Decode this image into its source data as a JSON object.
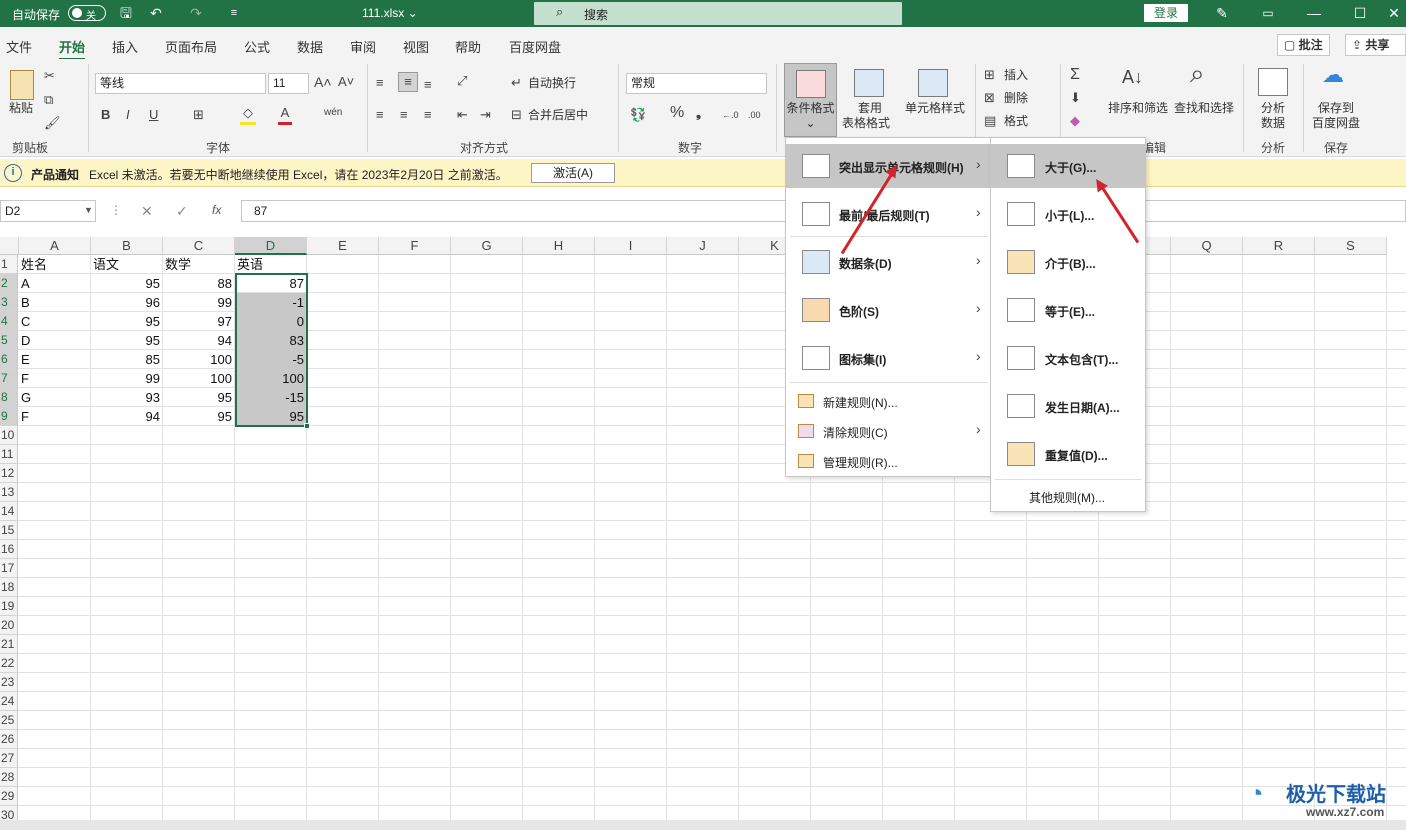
{
  "titlebar": {
    "autosave": "自动保存",
    "autosave_state": "关",
    "filename": "111.xlsx ⌄",
    "search": "搜索",
    "login": "登录"
  },
  "menu": {
    "tabs": [
      "文件",
      "开始",
      "插入",
      "页面布局",
      "公式",
      "数据",
      "审阅",
      "视图",
      "帮助",
      "百度网盘"
    ],
    "comments": "批注",
    "share": "共享"
  },
  "ribbon": {
    "paste": "粘贴",
    "clipboard": "剪贴板",
    "font_name": "等线",
    "font_size": "11",
    "font_group": "字体",
    "wrap": "自动换行",
    "merge": "合并后居中",
    "align_group": "对齐方式",
    "number_format": "常规",
    "number_group": "数字",
    "cond_format": "条件格式",
    "table_format_1": "套用",
    "table_format_2": "表格格式",
    "cell_style": "单元格样式",
    "insert": "插入",
    "delete": "删除",
    "format": "格式",
    "sort": "排序和筛选",
    "find": "查找和选择",
    "edit_group": "编辑",
    "analyze_1": "分析",
    "analyze_2": "数据",
    "analyze_group": "分析",
    "save_1": "保存到",
    "save_2": "百度网盘",
    "save_group": "保存"
  },
  "notice": {
    "title": "产品通知",
    "text": "Excel 未激活。若要无中断地继续使用 Excel，请在 2023年2月20日 之前激活。",
    "button": "激活(A)"
  },
  "formula": {
    "namebox": "D2",
    "value": "87"
  },
  "grid": {
    "columns": [
      "A",
      "B",
      "C",
      "D",
      "E",
      "F",
      "G",
      "H",
      "I",
      "J",
      "K",
      "L",
      "M",
      "N",
      "O",
      "P",
      "Q",
      "R",
      "S"
    ],
    "rows": [
      "1",
      "2",
      "3",
      "4",
      "5",
      "6",
      "7",
      "8",
      "9",
      "10",
      "11",
      "12",
      "13",
      "14",
      "15",
      "16",
      "17",
      "18",
      "19",
      "20",
      "21",
      "22",
      "23",
      "24",
      "25",
      "26",
      "27",
      "28",
      "29",
      "30"
    ],
    "data": [
      [
        "姓名",
        "语文",
        "数学",
        "英语"
      ],
      [
        "A",
        "95",
        "88",
        "87"
      ],
      [
        "B",
        "96",
        "99",
        "-1"
      ],
      [
        "C",
        "95",
        "97",
        "0"
      ],
      [
        "D",
        "95",
        "94",
        "83"
      ],
      [
        "E",
        "85",
        "100",
        "-5"
      ],
      [
        "F",
        "99",
        "100",
        "100"
      ],
      [
        "G",
        "93",
        "95",
        "-15"
      ],
      [
        "F",
        "94",
        "95",
        "95"
      ]
    ]
  },
  "cf_menu": {
    "items": [
      "突出显示单元格规则(H)",
      "最前/最后规则(T)",
      "数据条(D)",
      "色阶(S)",
      "图标集(I)"
    ],
    "small": [
      "新建规则(N)...",
      "清除规则(C)",
      "管理规则(R)..."
    ]
  },
  "sub_menu": {
    "items": [
      "大于(G)...",
      "小于(L)...",
      "介于(B)...",
      "等于(E)...",
      "文本包含(T)...",
      "发生日期(A)...",
      "重复值(D)..."
    ],
    "more": "其他规则(M)..."
  },
  "watermark": {
    "text": "极光下载站",
    "url": "www.xz7.com"
  }
}
